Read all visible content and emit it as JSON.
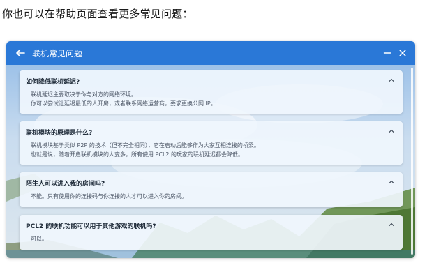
{
  "intro_text": "你也可以在帮助页面查看更多常见问题：",
  "window": {
    "title": "联机常见问题",
    "accent": "#2a78d7",
    "icons": {
      "back": "arrow-left-icon",
      "minimize": "minimize-icon",
      "close": "close-icon"
    }
  },
  "faq": [
    {
      "question": "如何降低联机延迟?",
      "answer_lines": [
        "联机延迟主要取决于你与对方的网络环境。",
        "你可以尝试让延迟最低的人开房，或者联系网络运营商，要求更换公网 IP。"
      ]
    },
    {
      "question": "联机模块的原理是什么?",
      "answer_lines": [
        "联机模块基于类似 P2P 的技术（但不完全相同），它在启动后能够作为大家互相连接的桥梁。",
        "也就是说，随着开启联机模块的人变多，所有使用 PCL2 的玩家的联机延迟都会降低。"
      ]
    },
    {
      "question": "陌生人可以进入我的房间吗?",
      "answer_lines": [
        "不能。只有使用你的连接码与你连接的人才可以进入你的房间。"
      ]
    },
    {
      "question": "PCL2 的联机功能可以用于其他游戏的联机吗?",
      "answer_lines": [
        "可以。"
      ]
    }
  ]
}
